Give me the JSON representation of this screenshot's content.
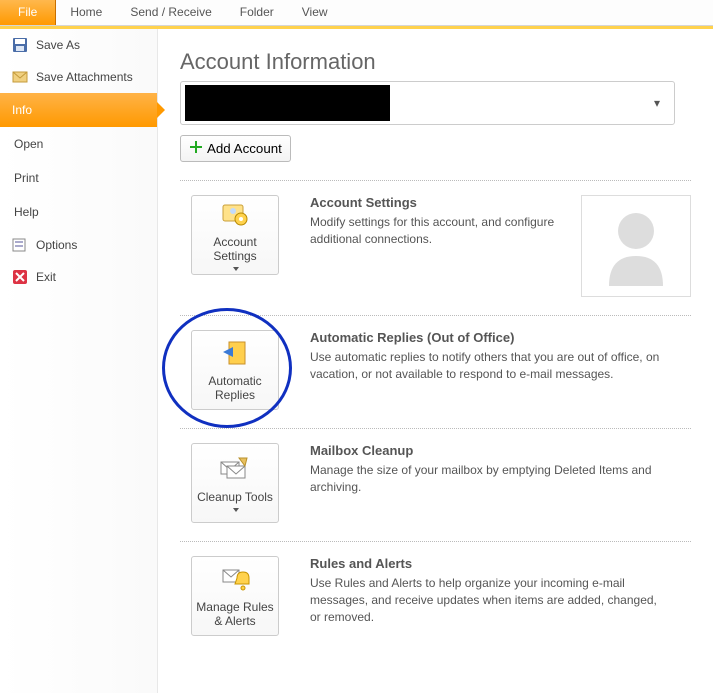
{
  "ribbon": {
    "file": "File",
    "tabs": [
      "Home",
      "Send / Receive",
      "Folder",
      "View"
    ]
  },
  "sidebar": {
    "save_as": "Save As",
    "save_attachments": "Save Attachments",
    "info": "Info",
    "open": "Open",
    "print": "Print",
    "help": "Help",
    "options": "Options",
    "exit": "Exit"
  },
  "main": {
    "title": "Account Information",
    "add_account": "Add Account",
    "sections": {
      "settings": {
        "btn": "Account Settings",
        "title": "Account Settings",
        "desc": "Modify settings for this account, and configure additional connections."
      },
      "autoreplies": {
        "btn": "Automatic Replies",
        "title": "Automatic Replies (Out of Office)",
        "desc": "Use automatic replies to notify others that you are out of office, on vacation, or not available to respond to e-mail messages."
      },
      "cleanup": {
        "btn": "Cleanup Tools",
        "title": "Mailbox Cleanup",
        "desc": "Manage the size of your mailbox by emptying Deleted Items and archiving."
      },
      "rules": {
        "btn": "Manage Rules & Alerts",
        "title": "Rules and Alerts",
        "desc": "Use Rules and Alerts to help organize your incoming e-mail messages, and receive updates when items are added, changed, or removed."
      }
    }
  }
}
